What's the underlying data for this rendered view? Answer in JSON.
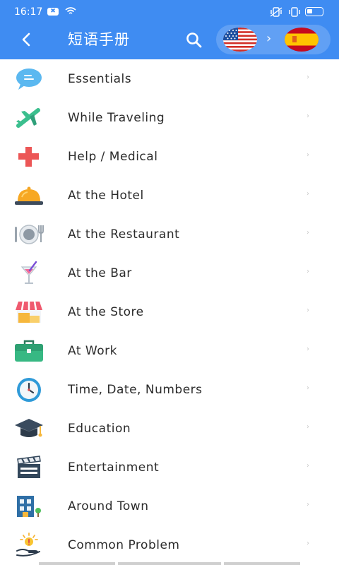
{
  "status": {
    "time": "16:17",
    "notif_badge": "✖"
  },
  "header": {
    "title": "短语手册",
    "arrow": "›",
    "from_lang": "us-flag-icon",
    "to_lang": "spain-flag-icon",
    "bg_color": "#3f8cf2"
  },
  "categories": [
    {
      "label": "Essentials",
      "icon": "speech-bubble-icon"
    },
    {
      "label": "While Traveling",
      "icon": "airplane-icon"
    },
    {
      "label": "Help / Medical",
      "icon": "medical-cross-icon"
    },
    {
      "label": "At the Hotel",
      "icon": "service-bell-icon"
    },
    {
      "label": "At the Restaurant",
      "icon": "plate-cutlery-icon"
    },
    {
      "label": "At the Bar",
      "icon": "cocktail-icon"
    },
    {
      "label": "At the Store",
      "icon": "storefront-icon"
    },
    {
      "label": "At Work",
      "icon": "briefcase-icon"
    },
    {
      "label": "Time, Date, Numbers",
      "icon": "clock-icon"
    },
    {
      "label": "Education",
      "icon": "graduation-cap-icon"
    },
    {
      "label": "Entertainment",
      "icon": "clapperboard-icon"
    },
    {
      "label": "Around Town",
      "icon": "building-icon"
    },
    {
      "label": "Common Problem",
      "icon": "idea-hand-icon"
    }
  ],
  "row_chevron": "›"
}
